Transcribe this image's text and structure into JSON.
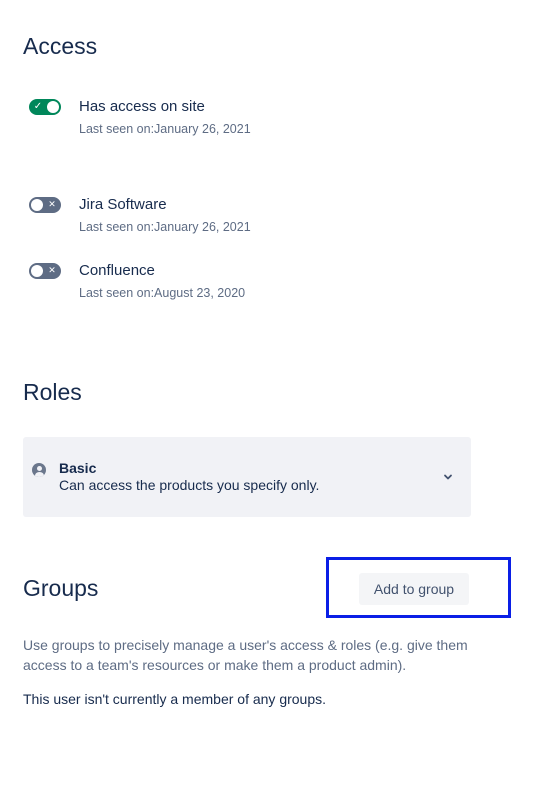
{
  "access": {
    "heading": "Access",
    "items": [
      {
        "title": "Has access on site",
        "last_seen": "Last seen on:January 26, 2021",
        "enabled": true
      },
      {
        "title": "Jira Software",
        "last_seen": "Last seen on:January 26, 2021",
        "enabled": false
      },
      {
        "title": "Confluence",
        "last_seen": "Last seen on:August 23, 2020",
        "enabled": false
      }
    ]
  },
  "roles": {
    "heading": "Roles",
    "selected": {
      "name": "Basic",
      "description": "Can access the products you specify only."
    },
    "icons": {
      "role": "user-avatar-icon",
      "expand": "chevron-down-icon"
    }
  },
  "groups": {
    "heading": "Groups",
    "add_button_label": "Add to group",
    "description": "Use groups to precisely manage a user's access & roles (e.g. give them access to a team's resources or make them a product admin).",
    "empty_message": "This user isn't currently a member of any groups."
  },
  "colors": {
    "toggle_on": "#00875a",
    "toggle_off": "#5e6c84",
    "heading_text": "#172b4d",
    "secondary_text": "#5e6c84",
    "highlight_border": "#0a1fe6",
    "role_card_bg": "#f1f2f6"
  }
}
